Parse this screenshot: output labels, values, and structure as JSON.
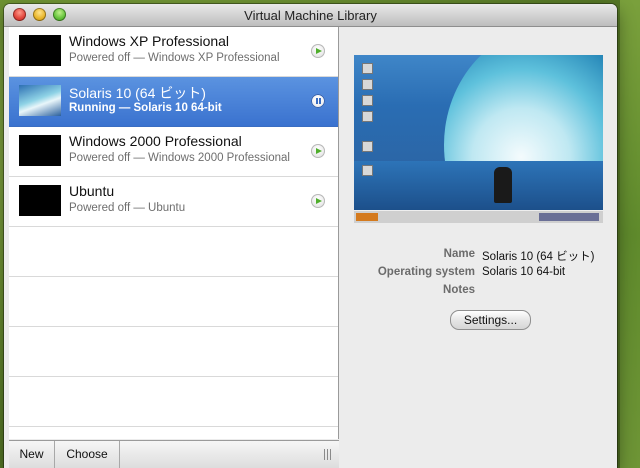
{
  "window": {
    "title": "Virtual Machine Library"
  },
  "vms": [
    {
      "name": "Windows XP Professional",
      "status": "Powered off — Windows XP Professional",
      "state": "off"
    },
    {
      "name": "Solaris 10 (64 ビット)",
      "status": "Running — Solaris 10 64-bit",
      "state": "running"
    },
    {
      "name": "Windows 2000 Professional",
      "status": "Powered off — Windows 2000 Professional",
      "state": "off"
    },
    {
      "name": "Ubuntu",
      "status": "Powered off — Ubuntu",
      "state": "off"
    }
  ],
  "bottom_bar": {
    "new_label": "New",
    "choose_label": "Choose"
  },
  "details": {
    "name_label": "Name",
    "name_value": "Solaris 10 (64 ビット)",
    "os_label": "Operating system",
    "os_value": "Solaris 10 64-bit",
    "notes_label": "Notes",
    "notes_value": "",
    "settings_label": "Settings..."
  },
  "colors": {
    "selection": "#3a72cf",
    "play": "#4fae2b"
  }
}
